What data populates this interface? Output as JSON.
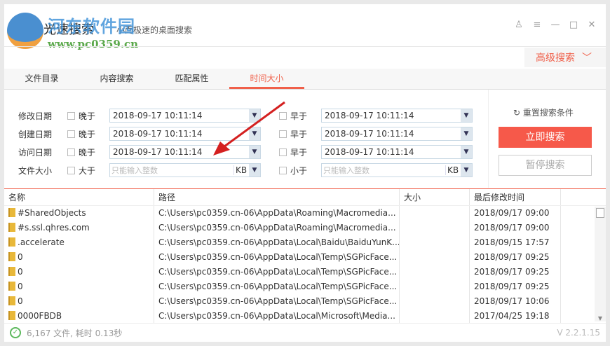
{
  "app": {
    "title": "光速搜索",
    "subtitle": "小而极速的桌面搜索"
  },
  "watermark": {
    "name": "河东软件园",
    "url": "www.pc0359.cn"
  },
  "window_controls": [
    "user-icon",
    "menu-icon",
    "minimize-icon",
    "maximize-icon",
    "close-icon"
  ],
  "advanced_label": "高级搜索",
  "tabs": [
    {
      "label": "文件目录"
    },
    {
      "label": "内容搜索"
    },
    {
      "label": "匹配属性"
    },
    {
      "label": "时间大小",
      "active": true
    }
  ],
  "form": {
    "rows": [
      {
        "label": "修改日期",
        "left_check": "晚于",
        "left_value": "2018-09-17 10:11:14",
        "right_check": "早于",
        "right_value": "2018-09-17 10:11:14"
      },
      {
        "label": "创建日期",
        "left_check": "晚于",
        "left_value": "2018-09-17 10:11:14",
        "right_check": "早于",
        "right_value": "2018-09-17 10:11:14"
      },
      {
        "label": "访问日期",
        "left_check": "晚于",
        "left_value": "2018-09-17 10:11:14",
        "right_check": "早于",
        "right_value": "2018-09-17 10:11:14"
      }
    ],
    "size": {
      "label": "文件大小",
      "left_check": "大于",
      "right_check": "小于",
      "placeholder": "只能输入整数",
      "unit": "KB"
    },
    "reset_label": "重置搜索条件",
    "search_label": "立即搜索",
    "pause_label": "暂停搜索"
  },
  "table": {
    "columns": [
      "名称",
      "路径",
      "大小",
      "最后修改时间"
    ],
    "rows": [
      {
        "name": "#SharedObjects",
        "path": "C:\\Users\\pc0359.cn-06\\AppData\\Roaming\\Macromedia...",
        "size": "",
        "modified": "2018/09/17 09:00"
      },
      {
        "name": "#s.ssl.qhres.com",
        "path": "C:\\Users\\pc0359.cn-06\\AppData\\Roaming\\Macromedia...",
        "size": "",
        "modified": "2018/09/17 09:00"
      },
      {
        "name": ".accelerate",
        "path": "C:\\Users\\pc0359.cn-06\\AppData\\Local\\Baidu\\BaiduYunK...",
        "size": "",
        "modified": "2018/09/15 17:57"
      },
      {
        "name": "0",
        "path": "C:\\Users\\pc0359.cn-06\\AppData\\Local\\Temp\\SGPicFace...",
        "size": "",
        "modified": "2018/09/17 09:25"
      },
      {
        "name": "0",
        "path": "C:\\Users\\pc0359.cn-06\\AppData\\Local\\Temp\\SGPicFace...",
        "size": "",
        "modified": "2018/09/17 09:25"
      },
      {
        "name": "0",
        "path": "C:\\Users\\pc0359.cn-06\\AppData\\Local\\Temp\\SGPicFace...",
        "size": "",
        "modified": "2018/09/17 09:25"
      },
      {
        "name": "0",
        "path": "C:\\Users\\pc0359.cn-06\\AppData\\Local\\Temp\\SGPicFace...",
        "size": "",
        "modified": "2018/09/17 10:06"
      },
      {
        "name": "0000FBDB",
        "path": "C:\\Users\\pc0359.cn-06\\AppData\\Local\\Microsoft\\Media...",
        "size": "",
        "modified": "2017/04/25 19:18"
      }
    ]
  },
  "status": {
    "text": "6,167 文件, 耗时 0.13秒",
    "version": "V 2.2.1.15"
  }
}
